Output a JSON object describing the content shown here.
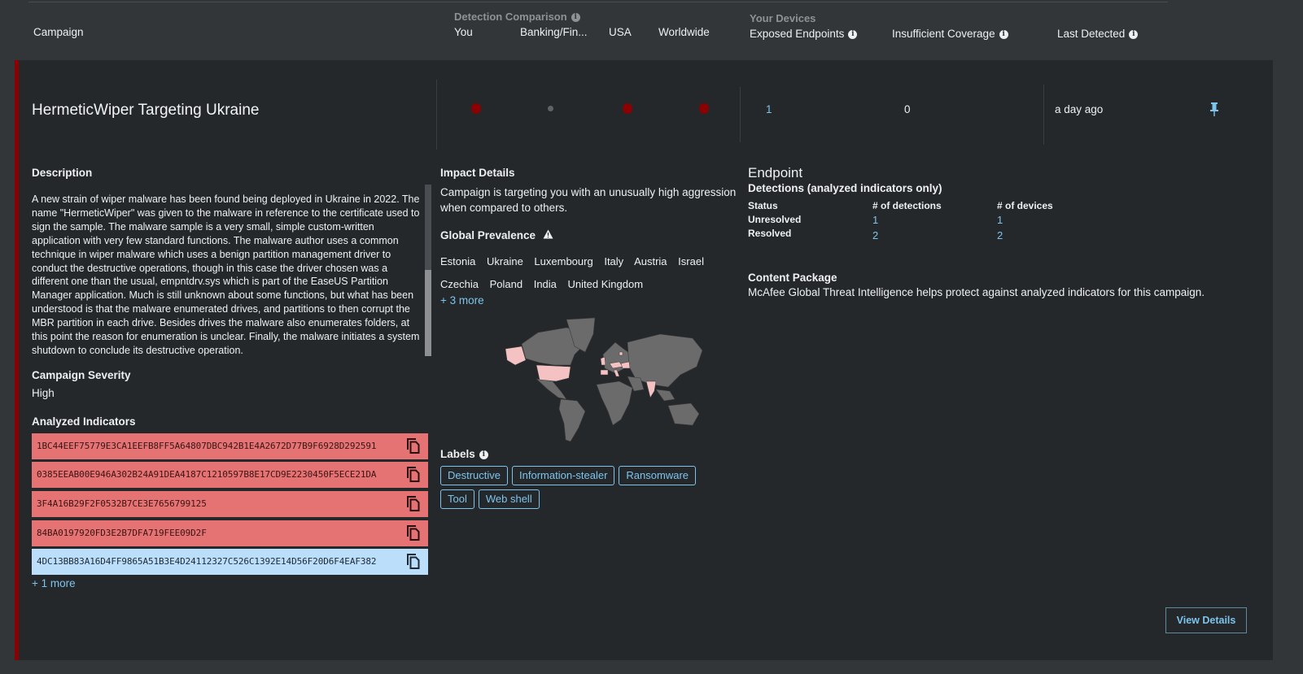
{
  "header": {
    "campaign": "Campaign",
    "detection_comparison": {
      "group_label": "Detection Comparison",
      "columns": [
        "You",
        "Banking/Fin...",
        "USA",
        "Worldwide"
      ]
    },
    "your_devices": {
      "group_label": "Your Devices",
      "exposed_endpoints": "Exposed Endpoints",
      "insufficient_coverage": "Insufficient Coverage"
    },
    "last_detected": "Last Detected"
  },
  "campaign": {
    "title": "HermeticWiper Targeting Ukraine",
    "comparison_levels": [
      {
        "column": "You",
        "level": "high",
        "color": "#8b0000"
      },
      {
        "column": "Banking/Fin...",
        "level": "low",
        "color": "#5f6366"
      },
      {
        "column": "USA",
        "level": "high",
        "color": "#8b0000"
      },
      {
        "column": "Worldwide",
        "level": "high",
        "color": "#8b0000"
      }
    ],
    "exposed_endpoints": "1",
    "insufficient_coverage": "0",
    "last_detected": "a day ago",
    "pin_icon": "pin-icon"
  },
  "description": {
    "title": "Description",
    "text": "A new strain of wiper malware has been found being deployed in Ukraine in 2022. The name \"HermeticWiper\" was given to the malware in reference to the certificate used to sign the sample. The malware sample is a very small, simple custom-written application with very few standard functions. The malware author uses a common technique in wiper malware which uses a benign partition management driver to conduct the destructive operations, though in this case the driver chosen was a different one than the usual, empntdrv.sys which is part of the EaseUS Partition Manager application. Much is still unknown about some functions, but what has been understood is that the malware enumerated drives, and partitions to then corrupt the MBR partition in each drive. Besides drives the malware also enumerates folders, at this point the reason for enumeration is unclear. Finally, the malware initiates a system shutdown to conclude its destructive operation."
  },
  "severity": {
    "title": "Campaign Severity",
    "value": "High"
  },
  "indicators": {
    "title": "Analyzed Indicators",
    "items": [
      {
        "hash": "1BC44EEF75779E3CA1EEFB8FF5A64807DBC942B1E4A2672D77B9F6928D292591",
        "state": "red"
      },
      {
        "hash": "0385EEAB00E946A302B24A91DEA4187C1210597B8E17CD9E2230450F5ECE21DA",
        "state": "red"
      },
      {
        "hash": "3F4A16B29F2F0532B7CE3E7656799125",
        "state": "red"
      },
      {
        "hash": "84BA0197920FD3E2B7DFA719FEE09D2F",
        "state": "red"
      },
      {
        "hash": "4DC13BB83A16D4FF9865A51B3E4D24112327C526C1392E14D56F20D6F4EAF382",
        "state": "blue"
      }
    ],
    "more": "+ 1 more",
    "colors": {
      "red": "#e57373",
      "blue": "#bbdefb"
    }
  },
  "impact": {
    "title": "Impact Details",
    "text": "Campaign is targeting you with an unusually high aggression when compared to others."
  },
  "prevalence": {
    "title": "Global Prevalence",
    "countries": [
      "Estonia",
      "Ukraine",
      "Luxembourg",
      "Italy",
      "Austria",
      "Israel",
      "Czechia",
      "Poland",
      "India",
      "United Kingdom"
    ],
    "more": "+ 3 more",
    "map_highlight_color": "#f4c2c2"
  },
  "labels": {
    "title": "Labels",
    "items": [
      "Destructive",
      "Information-stealer",
      "Ransomware",
      "Tool",
      "Web shell"
    ]
  },
  "endpoint": {
    "title": "Endpoint",
    "detections_title": "Detections (analyzed indicators only)",
    "columns": [
      "Status",
      "# of detections",
      "# of devices"
    ],
    "rows": [
      {
        "status": "Unresolved",
        "detections": "1",
        "devices": "1"
      },
      {
        "status": "Resolved",
        "detections": "2",
        "devices": "2"
      }
    ]
  },
  "content_package": {
    "title": "Content Package",
    "text": "McAfee Global Threat Intelligence helps protect against analyzed indicators for this campaign."
  },
  "actions": {
    "view_details": "View Details"
  },
  "colors": {
    "accent": "#7cc4ec",
    "severity_bar": "#8b0000",
    "card_bg": "#25282b",
    "page_bg": "#323638"
  }
}
